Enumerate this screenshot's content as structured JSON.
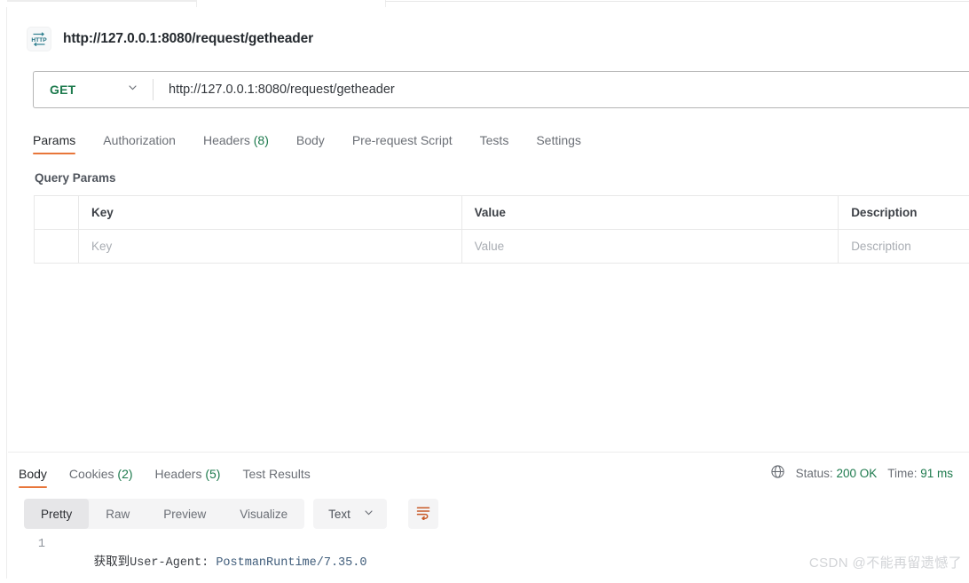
{
  "request": {
    "icon": "http-protocol-icon",
    "title": "http://127.0.0.1:8080/request/getheader",
    "method": "GET",
    "url": "http://127.0.0.1:8080/request/getheader",
    "tabs": [
      {
        "label": "Params",
        "count": "",
        "active": true
      },
      {
        "label": "Authorization",
        "count": "",
        "active": false
      },
      {
        "label": "Headers",
        "count": "(8)",
        "active": false
      },
      {
        "label": "Body",
        "count": "",
        "active": false
      },
      {
        "label": "Pre-request Script",
        "count": "",
        "active": false
      },
      {
        "label": "Tests",
        "count": "",
        "active": false
      },
      {
        "label": "Settings",
        "count": "",
        "active": false
      }
    ],
    "query_params": {
      "section_title": "Query Params",
      "columns": [
        "Key",
        "Value",
        "Description"
      ],
      "rows": [
        {
          "key": "Key",
          "value": "Value",
          "description": "Description"
        }
      ]
    }
  },
  "response": {
    "tabs": [
      {
        "label": "Body",
        "count": "",
        "active": true
      },
      {
        "label": "Cookies",
        "count": "(2)",
        "active": false
      },
      {
        "label": "Headers",
        "count": "(5)",
        "active": false
      },
      {
        "label": "Test Results",
        "count": "",
        "active": false
      }
    ],
    "status_icon": "globe-icon",
    "status_label": "Status:",
    "status_value": "200 OK",
    "time_label": "Time:",
    "time_value": "91 ms",
    "view_modes": [
      {
        "label": "Pretty",
        "active": true
      },
      {
        "label": "Raw",
        "active": false
      },
      {
        "label": "Preview",
        "active": false
      },
      {
        "label": "Visualize",
        "active": false
      }
    ],
    "format": "Text",
    "wrap_icon": "wrap-text-icon",
    "body": {
      "line_number": "1",
      "text_cn": "获取到",
      "text_key": "User-Agent: ",
      "text_value": "PostmanRuntime/7.35.0"
    }
  },
  "watermark": "CSDN @不能再留遗憾了",
  "colors": {
    "accent_orange": "#e8763a",
    "success_green": "#1d7a4d",
    "icon_teal": "#2f7f8f"
  }
}
